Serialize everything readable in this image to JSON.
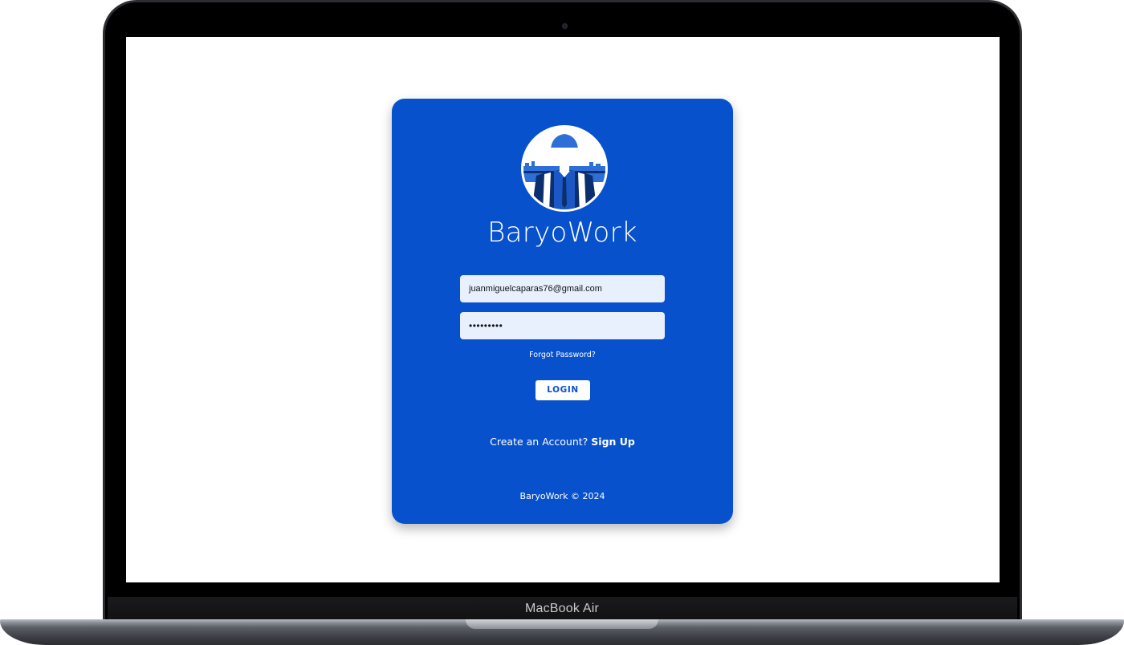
{
  "device": {
    "label": "MacBook Air"
  },
  "login": {
    "app_name": "BaryoWork",
    "logo_icon": "construction-worker-icon",
    "email_value": "juanmiguelcaparas76@gmail.com",
    "password_masked": "•••••••••",
    "forgot_password_label": "Forgot Password?",
    "login_label": "LOGIN",
    "signup_prompt": "Create an Account?",
    "signup_link": "Sign Up",
    "footer": "BaryoWork © 2024"
  },
  "colors": {
    "card": "#0751cc",
    "input_bg": "#e8f0fe",
    "button_bg": "#ffffff",
    "button_text": "#0751cc"
  }
}
